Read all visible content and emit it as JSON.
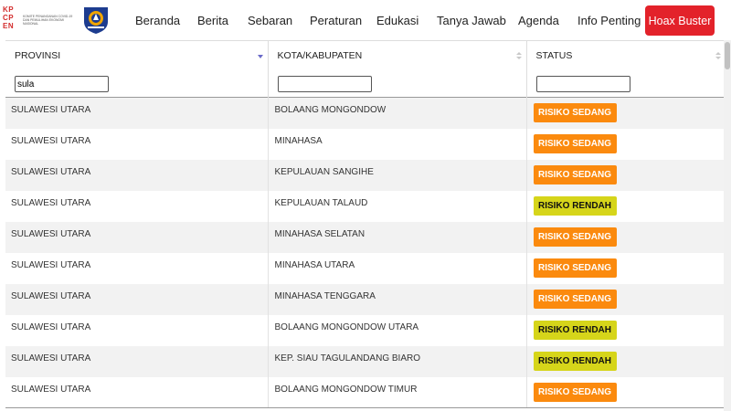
{
  "brand": {
    "kpc_letters": [
      "K",
      "P",
      "C",
      "P",
      "E",
      "N"
    ],
    "kpc_text": "Komite Penanganan COVID-19 dan Pemulihan Ekonomi Nasional"
  },
  "nav": {
    "items": [
      {
        "label": "Beranda"
      },
      {
        "label": "Berita"
      },
      {
        "label": "Sebaran"
      },
      {
        "label": "Peraturan"
      },
      {
        "label": "Edukasi"
      },
      {
        "label": "Tanya Jawab"
      },
      {
        "label": "Agenda"
      },
      {
        "label": "Info Penting"
      }
    ],
    "hoax_label": "Hoax Buster",
    "hoax_color": "#e3222a"
  },
  "table": {
    "columns": [
      "PROVINSI",
      "KOTA/KABUPATEN",
      "STATUS"
    ],
    "sorted_column_icon": "sort-desc-icon",
    "filters": {
      "provinsi": "sula",
      "kota": "",
      "status": ""
    },
    "status_colors": {
      "RISIKO SEDANG": "#fb8a0e",
      "RISIKO RENDAH": "#d6d51a"
    },
    "rows": [
      {
        "provinsi": "SULAWESI UTARA",
        "kota": "BOLAANG MONGONDOW",
        "status": "RISIKO SEDANG"
      },
      {
        "provinsi": "SULAWESI UTARA",
        "kota": "MINAHASA",
        "status": "RISIKO SEDANG"
      },
      {
        "provinsi": "SULAWESI UTARA",
        "kota": "KEPULAUAN SANGIHE",
        "status": "RISIKO SEDANG"
      },
      {
        "provinsi": "SULAWESI UTARA",
        "kota": "KEPULAUAN TALAUD",
        "status": "RISIKO RENDAH"
      },
      {
        "provinsi": "SULAWESI UTARA",
        "kota": "MINAHASA SELATAN",
        "status": "RISIKO SEDANG"
      },
      {
        "provinsi": "SULAWESI UTARA",
        "kota": "MINAHASA UTARA",
        "status": "RISIKO SEDANG"
      },
      {
        "provinsi": "SULAWESI UTARA",
        "kota": "MINAHASA TENGGARA",
        "status": "RISIKO SEDANG"
      },
      {
        "provinsi": "SULAWESI UTARA",
        "kota": "BOLAANG MONGONDOW UTARA",
        "status": "RISIKO RENDAH"
      },
      {
        "provinsi": "SULAWESI UTARA",
        "kota": "KEP. SIAU TAGULANDANG BIARO",
        "status": "RISIKO RENDAH"
      },
      {
        "provinsi": "SULAWESI UTARA",
        "kota": "BOLAANG MONGONDOW TIMUR",
        "status": "RISIKO SEDANG"
      }
    ]
  }
}
